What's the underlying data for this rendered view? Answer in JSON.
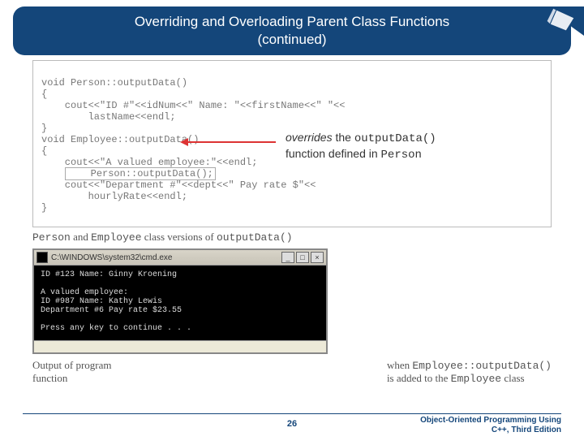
{
  "title_line1": "Overriding and Overloading Parent Class Functions",
  "title_line2": "(continued)",
  "code": {
    "l1": "void Person::outputData()",
    "l2": "{",
    "l3": "    cout<<\"ID #\"<<idNum<<\" Name: \"<<firstName<<\" \"<<",
    "l4": "        lastName<<endl;",
    "l5": "}",
    "l6": "void Employee::outputData()",
    "l7": "{",
    "l8": "    cout<<\"A valued employee:\"<<endl;",
    "l9": "    Person::outputData();",
    "l10": "    cout<<\"Department #\"<<dept<<\" Pay rate $\"<<",
    "l11": "        hourlyRate<<endl;",
    "l12": "}"
  },
  "callout": {
    "t1": "overrides",
    "t2": " the ",
    "t3": "outputData()",
    "t4": "function defined in ",
    "t5": "Person"
  },
  "figcap1": {
    "a": "Person",
    "b": " and ",
    "c": "Employee",
    "d": " class versions of ",
    "e": "outputData()"
  },
  "cmd": {
    "title": "C:\\WINDOWS\\system32\\cmd.exe",
    "l1": "ID #123 Name: Ginny Kroening",
    "l2": "",
    "l3": "A valued employee:",
    "l4": "ID #987 Name: Kathy Lewis",
    "l5": "Department #6 Pay rate $23.55",
    "l6": "",
    "l7": "Press any key to continue . . ."
  },
  "figcap2": {
    "left_a": "Output of program",
    "left_b": "function",
    "right_a": "when ",
    "right_b": "Employee::outputData()",
    "right_c": "is added to the ",
    "right_d": "Employee",
    "right_e": " class"
  },
  "page_num": "26",
  "book_l1": "Object-Oriented Programming Using",
  "book_l2": "C++, Third Edition",
  "btn_min": "_",
  "btn_max": "□",
  "btn_close": "×"
}
